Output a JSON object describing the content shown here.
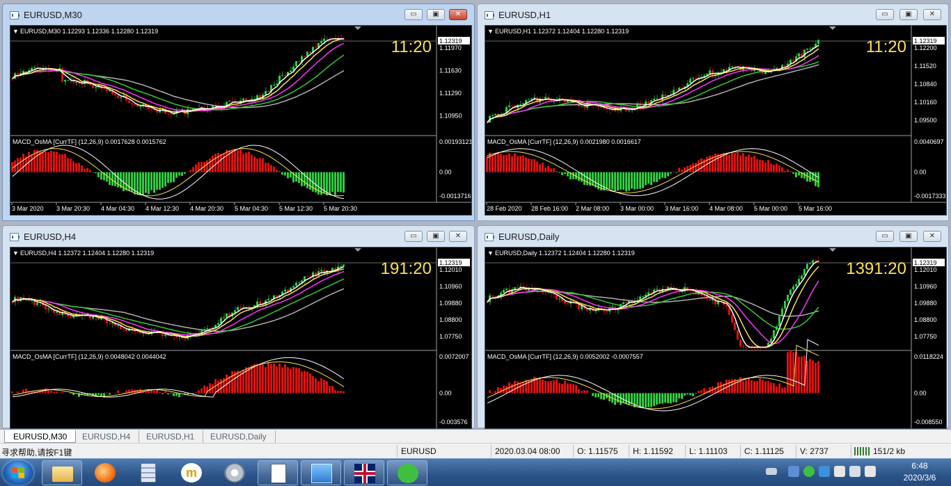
{
  "windows": [
    {
      "id": "m30",
      "title": "EURUSD,M30",
      "active": true,
      "header": "EURUSD,M30  1.12293 1.12336 1.12280 1.12319",
      "timer": "11:20",
      "price_labels": [
        "1.12319",
        "1.11970",
        "1.11630",
        "1.11290",
        "1.10950"
      ],
      "macd_header": "MACD_OsMA [CurrTF] (12,26,9) 0.0017628 0.0015762",
      "macd_labels": [
        "0.00193121",
        "0.00",
        "-0.0013716"
      ],
      "time_labels": [
        "3 Mar 2020",
        "3 Mar 20:30",
        "4 Mar 04:30",
        "4 Mar 12:30",
        "4 Mar 20:30",
        "5 Mar 04:30",
        "5 Mar 12:30",
        "5 Mar 20:30"
      ]
    },
    {
      "id": "h1",
      "title": "EURUSD,H1",
      "active": false,
      "header": "EURUSD,H1  1.12372 1.12404 1.12280 1.12319",
      "timer": "11:20",
      "price_labels": [
        "1.12319",
        "1.12200",
        "1.11520",
        "1.10840",
        "1.10160",
        "1.09500"
      ],
      "macd_header": "MACD_OsMA [CurrTF] (12,26,9) 0.0021980 0.0016617",
      "macd_labels": [
        "0.0040697",
        "0.00",
        "-0.0017333"
      ],
      "time_labels": [
        "28 Feb 2020",
        "28 Feb 16:00",
        "2 Mar 08:00",
        "3 Mar 00:00",
        "3 Mar 16:00",
        "4 Mar 08:00",
        "5 Mar 00:00",
        "5 Mar 16:00"
      ]
    },
    {
      "id": "h4",
      "title": "EURUSD,H4",
      "active": false,
      "header": "EURUSD,H4  1.12372 1.12404 1.12280 1.12319",
      "timer": "191:20",
      "price_labels": [
        "1.12319",
        "1.12010",
        "1.10960",
        "1.09880",
        "1.08800",
        "1.07750"
      ],
      "macd_header": "MACD_OsMA [CurrTF] (12,26,9) 0.0048042 0.0044042",
      "macd_labels": [
        "0.0072007",
        "0.00",
        "-0.003576"
      ]
    },
    {
      "id": "daily",
      "title": "EURUSD,Daily",
      "active": false,
      "header": "EURUSD,Daily  1.12372 1.12404 1.12280 1.12319",
      "timer": "1391:20",
      "price_labels": [
        "1.12319",
        "1.12010",
        "1.10960",
        "1.09880",
        "1.08800",
        "1.07750"
      ],
      "macd_header": "MACD_OsMA [CurrTF] (12,26,9) 0.0052002 -0.0007557",
      "macd_labels": [
        "0.0118224",
        "0.00",
        "-0.008550"
      ]
    }
  ],
  "window_buttons": {
    "minimize": "▭",
    "maximize": "▣",
    "close": "✕"
  },
  "tabs": [
    "EURUSD,M30",
    "EURUSD,H4",
    "EURUSD,H1",
    "EURUSD,Daily"
  ],
  "status": {
    "help": "寻求帮助,请按F1键",
    "symbol": "EURUSD",
    "datetime": "2020.03.04 08:00",
    "open": "O: 1.11575",
    "high": "H: 1.11592",
    "low": "L: 1.11103",
    "close": "C: 1.11125",
    "volume": "V: 2737",
    "traffic": "151/2 kb"
  },
  "clock": {
    "time": "6:48",
    "date": "2020/3/6"
  },
  "colors": {
    "bull": "#2ecc40",
    "bear": "#e01010",
    "ma_fast": "#ffffff",
    "ma_yellow": "#ffe14d",
    "ma_magenta": "#ff33ff",
    "ma_green": "#33cc33",
    "ma_gray": "#b0b0b0",
    "timer": "#ffe14d"
  }
}
